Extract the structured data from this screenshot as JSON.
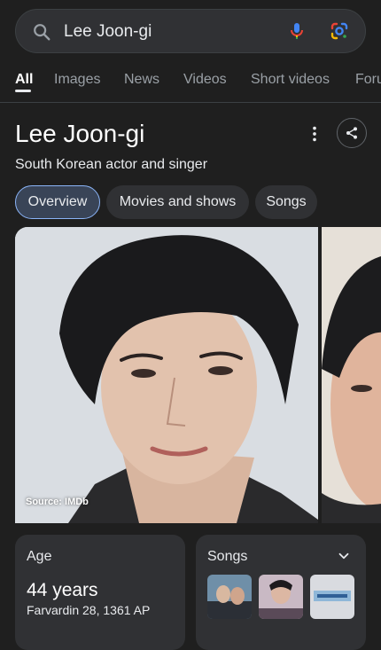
{
  "search": {
    "query": "Lee Joon-gi"
  },
  "tabs": [
    {
      "label": "All",
      "active": true
    },
    {
      "label": "Images"
    },
    {
      "label": "News"
    },
    {
      "label": "Videos"
    },
    {
      "label": "Short videos"
    },
    {
      "label": "Foru"
    }
  ],
  "entity": {
    "title": "Lee Joon-gi",
    "subtitle": "South Korean actor and singer"
  },
  "chips": [
    {
      "label": "Overview",
      "selected": true
    },
    {
      "label": "Movies and shows"
    },
    {
      "label": "Songs"
    }
  ],
  "images": {
    "source": "Source: IMDb"
  },
  "age_card": {
    "label": "Age",
    "value": "44 years",
    "date": "Farvardin 28, 1361 AP"
  },
  "songs_card": {
    "label": "Songs"
  },
  "colors": {
    "background": "#1f1f1f",
    "surface": "#303134",
    "accent": "#8ab4f8",
    "selected_chip": "#394457"
  },
  "icons": [
    "search-icon",
    "mic-icon",
    "google-lens-icon",
    "more-vert-icon",
    "share-icon",
    "chevron-down-icon"
  ]
}
